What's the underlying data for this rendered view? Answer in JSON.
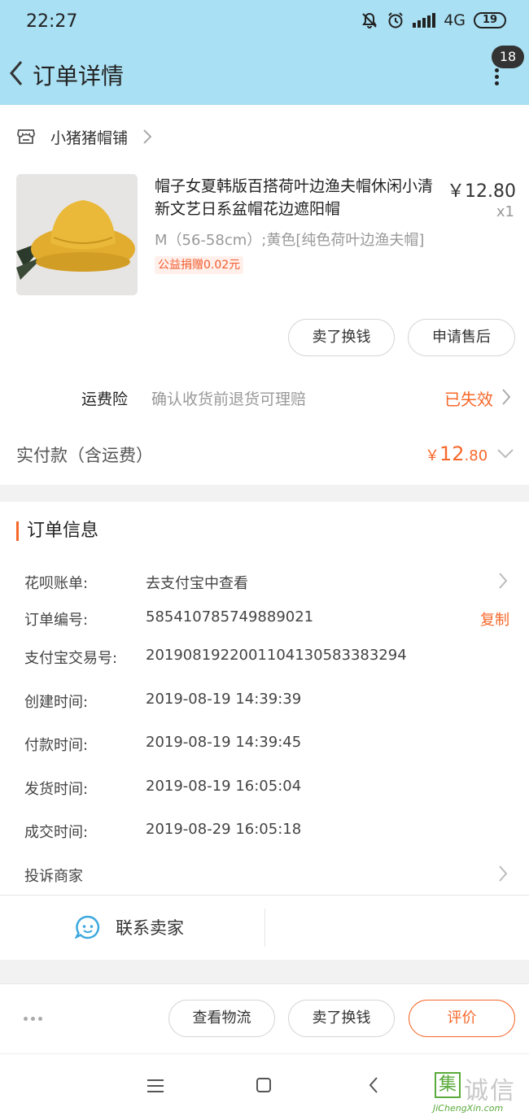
{
  "status_bar": {
    "time": "22:27",
    "network": "4G",
    "battery": "19"
  },
  "header": {
    "title": "订单详情",
    "badge_count": "18"
  },
  "shop": {
    "name": "小猪猪帽铺"
  },
  "product": {
    "title": "帽子女夏韩版百搭荷叶边渔夫帽休闲小清新文艺日系盆帽花边遮阳帽",
    "price": "￥12.80",
    "quantity": "x1",
    "spec": "M（56-58cm）;黄色[纯色荷叶边渔夫帽]",
    "charity": "公益捐赠0.02元"
  },
  "product_actions": {
    "sell": "卖了换钱",
    "after_sale": "申请售后"
  },
  "insurance": {
    "label": "运费险",
    "desc": "确认收货前退货可理赔",
    "status": "已失效"
  },
  "payment": {
    "label": "实付款（含运费）",
    "currency": "￥",
    "integer": "12",
    "decimal": ".80"
  },
  "order_info": {
    "title": "订单信息",
    "huabei_label": "花呗账单:",
    "huabei_value": "去支付宝中查看",
    "order_no_label": "订单编号:",
    "order_no": "585410785749889021",
    "copy_label": "复制",
    "alipay_no_label": "支付宝交易号:",
    "alipay_no": "2019081922001104130583383294",
    "created_label": "创建时间:",
    "created": "2019-08-19 14:39:39",
    "paid_label": "付款时间:",
    "paid": "2019-08-19 14:39:45",
    "shipped_label": "发货时间:",
    "shipped": "2019-08-19 16:05:04",
    "completed_label": "成交时间:",
    "completed": "2019-08-29 16:05:18",
    "complain_label": "投诉商家",
    "contact_label": "联系卖家"
  },
  "bottom_actions": {
    "logistics": "查看物流",
    "sell": "卖了换钱",
    "review": "评价"
  },
  "watermark": {
    "brand": "诚信",
    "site": "JiChengXin.com",
    "logo_char": "集"
  },
  "colors": {
    "header_bg": "#a9e0f3",
    "accent": "#f7672a",
    "contact_icon": "#3fa9de"
  }
}
